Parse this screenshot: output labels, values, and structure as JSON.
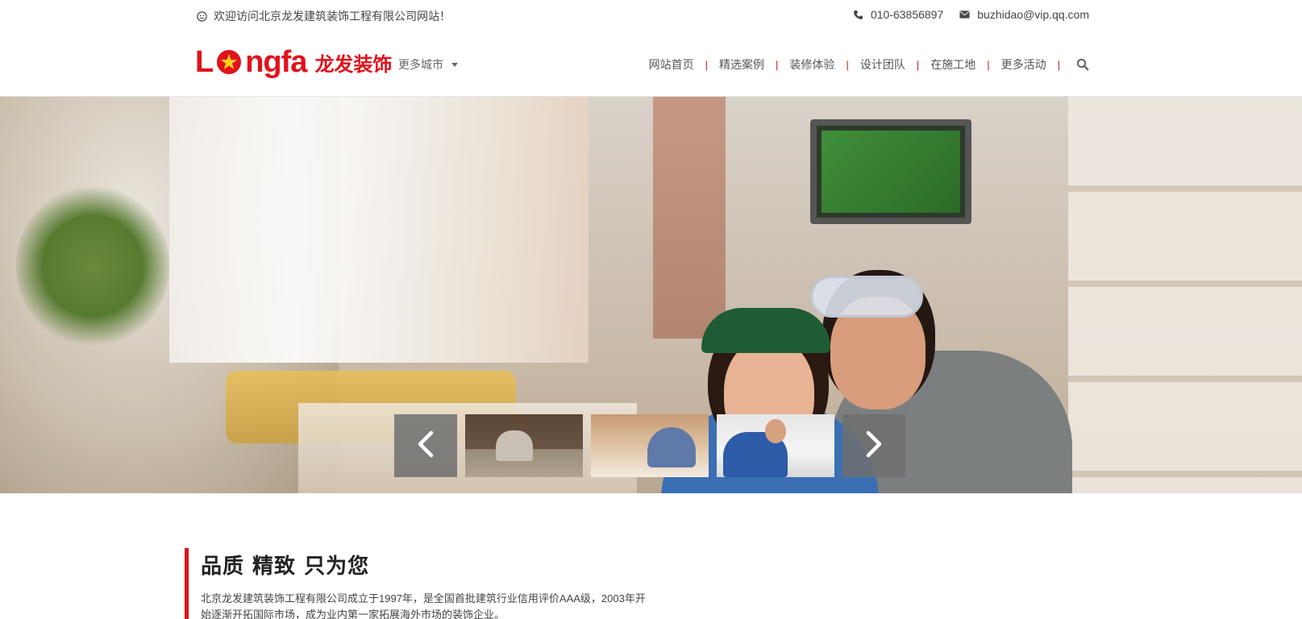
{
  "topbar": {
    "welcome": "欢迎访问北京龙发建筑装饰工程有限公司网站！",
    "phone": "010-63856897",
    "email": "buzhidao@vip.qq.com"
  },
  "logo": {
    "latin_prefix": "L",
    "latin_suffix": "ngfa",
    "cn": "龙发装饰"
  },
  "city_selector": {
    "label": "更多城市"
  },
  "nav": {
    "items": [
      "网站首页",
      "精选案例",
      "装修体验",
      "设计团队",
      "在施工地",
      "更多活动"
    ],
    "separator": "|"
  },
  "intro": {
    "title": "品质 精致 只为您",
    "text": "北京龙发建筑装饰工程有限公司成立于1997年，是全国首批建筑行业信用评价AAA级，2003年开始逐渐开拓国际市场，成为业内第一家拓展海外市场的装饰企业。"
  },
  "colors": {
    "brand": "#e1121b",
    "nav_text": "#555555",
    "arrow_bg": "#6e6e6e"
  },
  "icons": {
    "welcome": "smile-icon",
    "phone": "phone-icon",
    "email": "envelope-icon",
    "search": "search-icon",
    "prev": "chevron-left-icon",
    "next": "chevron-right-icon"
  }
}
